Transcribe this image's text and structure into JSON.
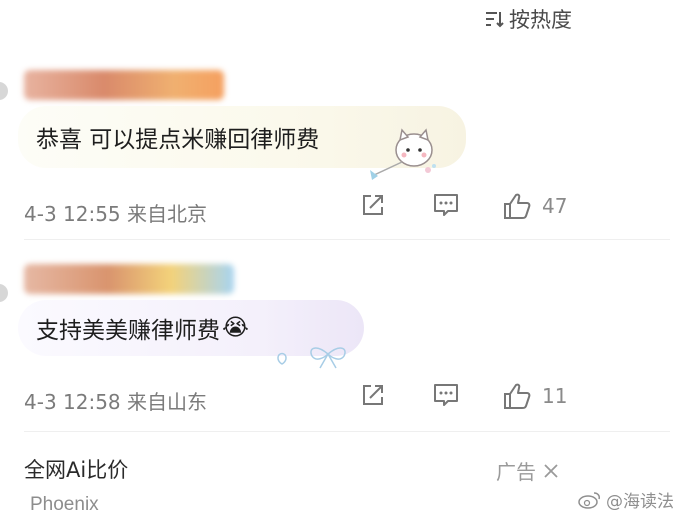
{
  "sort": {
    "label": "按热度",
    "icon": "sort-icon"
  },
  "comments": [
    {
      "text": "恭喜 可以提点米赚回律师费",
      "time": "4-3 12:55",
      "location": "来自北京",
      "likes": "47",
      "sticker_icon": "cat-sticker-icon"
    },
    {
      "text": "支持美美赚律师费",
      "emoji": "😭",
      "time": "4-3 12:58",
      "location": "来自山东",
      "likes": "11",
      "sticker_icon": "bow-sticker-icon"
    }
  ],
  "ad": {
    "title": "全网Ai比价",
    "brand": "Phoenix",
    "tag": "广告"
  },
  "watermark": "@海读法"
}
